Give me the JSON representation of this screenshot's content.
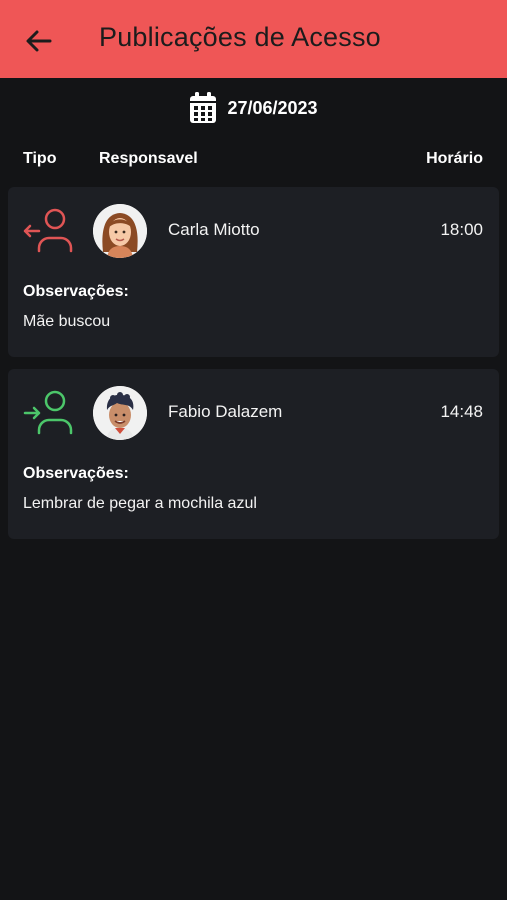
{
  "header": {
    "title": "Publicações de Acesso",
    "back_icon": "arrow-left-icon",
    "background": "#ef5656"
  },
  "date": {
    "icon": "calendar-icon",
    "value": "27/06/2023"
  },
  "columns": {
    "type": "Tipo",
    "responsible": "Responsavel",
    "time": "Horário"
  },
  "records": [
    {
      "type": "exit",
      "type_icon": "user-exit-icon",
      "type_color": "#e05555",
      "avatar": "avatar-female",
      "name": "Carla Miotto",
      "time": "18:00",
      "obs_label": "Observações:",
      "obs_text": "Mãe buscou"
    },
    {
      "type": "entry",
      "type_icon": "user-entry-icon",
      "type_color": "#4cc66a",
      "avatar": "avatar-male",
      "name": "Fabio Dalazem",
      "time": "14:48",
      "obs_label": "Observações:",
      "obs_text": "Lembrar de pegar a mochila azul"
    }
  ]
}
